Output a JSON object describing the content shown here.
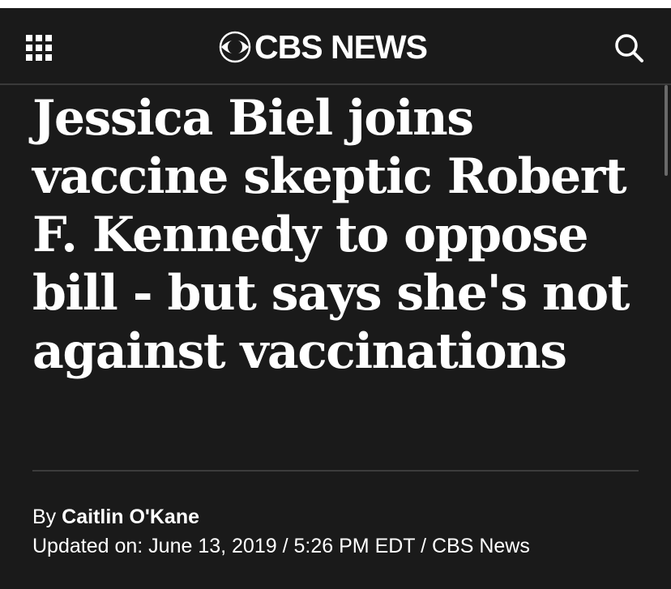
{
  "header": {
    "brand": "CBS NEWS",
    "menu_icon": "grid-menu-icon",
    "search_icon": "search-icon",
    "logo_icon": "cbs-eye-icon",
    "background_color": "#1a1a1a",
    "text_color": "#ffffff"
  },
  "article": {
    "headline": "Jessica Biel joins vaccine skeptic Robert F. Kennedy to oppose bill - but says she's not against vaccinations",
    "byline": {
      "prefix": "By",
      "author": "Caitlin O'Kane"
    },
    "dateline": {
      "label": "Updated on:",
      "date": "June 13, 2019",
      "separator": "/",
      "time": "5:26 PM EDT",
      "source": "CBS News"
    }
  }
}
